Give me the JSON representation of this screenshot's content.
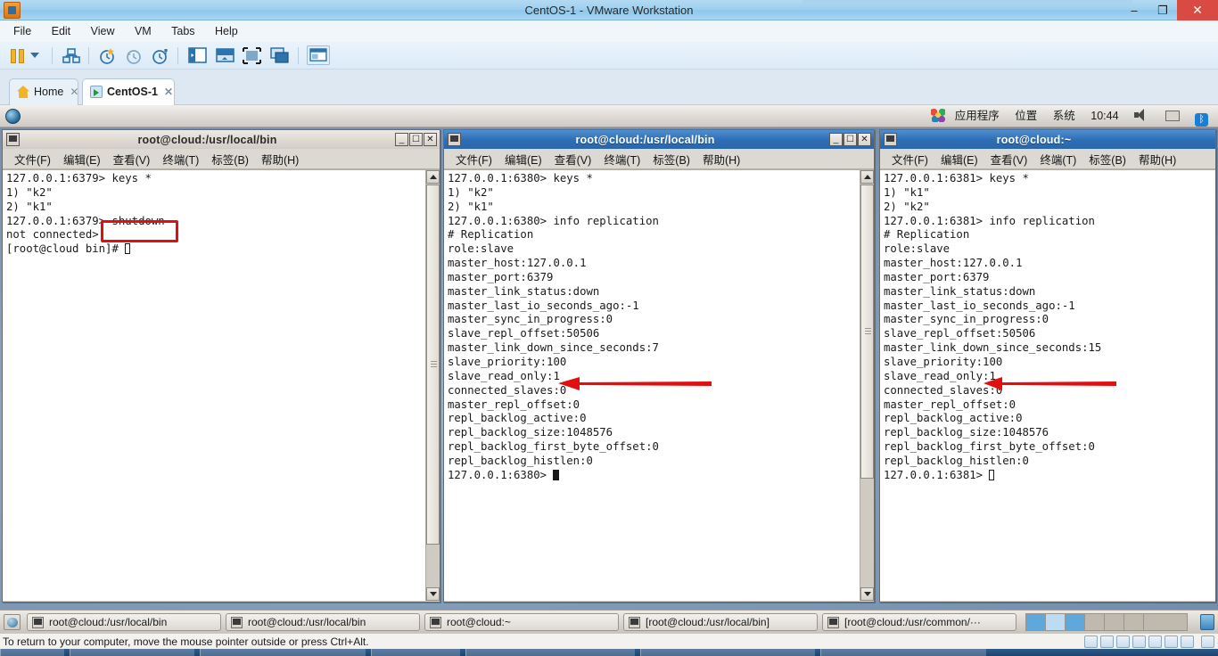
{
  "window": {
    "title": "CentOS-1 - VMware Workstation",
    "minimize_label": "–",
    "maximize_label": "❐",
    "close_label": "✕"
  },
  "menubar": {
    "items": [
      "File",
      "Edit",
      "View",
      "VM",
      "Tabs",
      "Help"
    ]
  },
  "tabs": [
    {
      "label": "Home",
      "icon": "home-icon",
      "close": "✕",
      "active": false
    },
    {
      "label": "CentOS-1",
      "icon": "vm-icon",
      "close": "✕",
      "active": true
    }
  ],
  "gnome_panel": {
    "menus": [
      "应用程序",
      "位置",
      "系统"
    ],
    "clock": "10:44",
    "icons": [
      "volume-icon",
      "display-icon",
      "bluetooth-icon"
    ],
    "bluetooth_glyph": "ᛒ"
  },
  "terminal_menu": [
    "文件(F)",
    "编辑(E)",
    "查看(V)",
    "终端(T)",
    "标签(B)",
    "帮助(H)"
  ],
  "terminals": [
    {
      "id": "terminal-left",
      "title": "root@cloud:/usr/local/bin",
      "active": false,
      "lines": [
        "127.0.0.1:6379> keys *",
        "1) \"k2\"",
        "2) \"k1\"",
        "127.0.0.1:6379> shutdown",
        "not connected>",
        "[root@cloud bin]# "
      ],
      "cursor": "hollow"
    },
    {
      "id": "terminal-middle",
      "title": "root@cloud:/usr/local/bin",
      "active": true,
      "lines": [
        "127.0.0.1:6380> keys *",
        "1) \"k2\"",
        "2) \"k1\"",
        "127.0.0.1:6380> info replication",
        "# Replication",
        "role:slave",
        "master_host:127.0.0.1",
        "master_port:6379",
        "master_link_status:down",
        "master_last_io_seconds_ago:-1",
        "master_sync_in_progress:0",
        "slave_repl_offset:50506",
        "master_link_down_since_seconds:7",
        "slave_priority:100",
        "slave_read_only:1",
        "connected_slaves:0",
        "master_repl_offset:0",
        "repl_backlog_active:0",
        "repl_backlog_size:1048576",
        "repl_backlog_first_byte_offset:0",
        "repl_backlog_histlen:0",
        "127.0.0.1:6380> "
      ],
      "cursor": "block"
    },
    {
      "id": "terminal-right",
      "title": "root@cloud:~",
      "active": true,
      "lines": [
        "127.0.0.1:6381> keys *",
        "1) \"k1\"",
        "2) \"k2\"",
        "127.0.0.1:6381> info replication",
        "# Replication",
        "role:slave",
        "master_host:127.0.0.1",
        "master_port:6379",
        "master_link_status:down",
        "master_last_io_seconds_ago:-1",
        "master_sync_in_progress:0",
        "slave_repl_offset:50506",
        "master_link_down_since_seconds:15",
        "slave_priority:100",
        "slave_read_only:1",
        "connected_slaves:0",
        "master_repl_offset:0",
        "repl_backlog_active:0",
        "repl_backlog_size:1048576",
        "repl_backlog_first_byte_offset:0",
        "repl_backlog_histlen:0",
        "127.0.0.1:6381> "
      ],
      "cursor": "hollow"
    }
  ],
  "annotations": {
    "highlight_color": "#e10f0f",
    "box_target": "shutdown",
    "arrow_targets": [
      "master_port:6379",
      "master_port:6379"
    ]
  },
  "guest_taskbar": {
    "buttons": [
      "root@cloud:/usr/local/bin",
      "root@cloud:/usr/local/bin",
      "root@cloud:~",
      "[root@cloud:/usr/local/bin]",
      "[root@cloud:/usr/common/···"
    ]
  },
  "status_bar": {
    "message": "To return to your computer, move the mouse pointer outside or press Ctrl+Alt."
  },
  "toolbar": {
    "icons": [
      "power-icon",
      "dropdown-caret-icon",
      "snapshot-manager-icon",
      "take-snapshot-icon",
      "revert-snapshot-icon",
      "manage-snapshots-icon",
      "show-library-icon",
      "show-thumbnails-icon",
      "enter-fullscreen-icon",
      "unity-mode-icon",
      "console-view-icon"
    ]
  }
}
